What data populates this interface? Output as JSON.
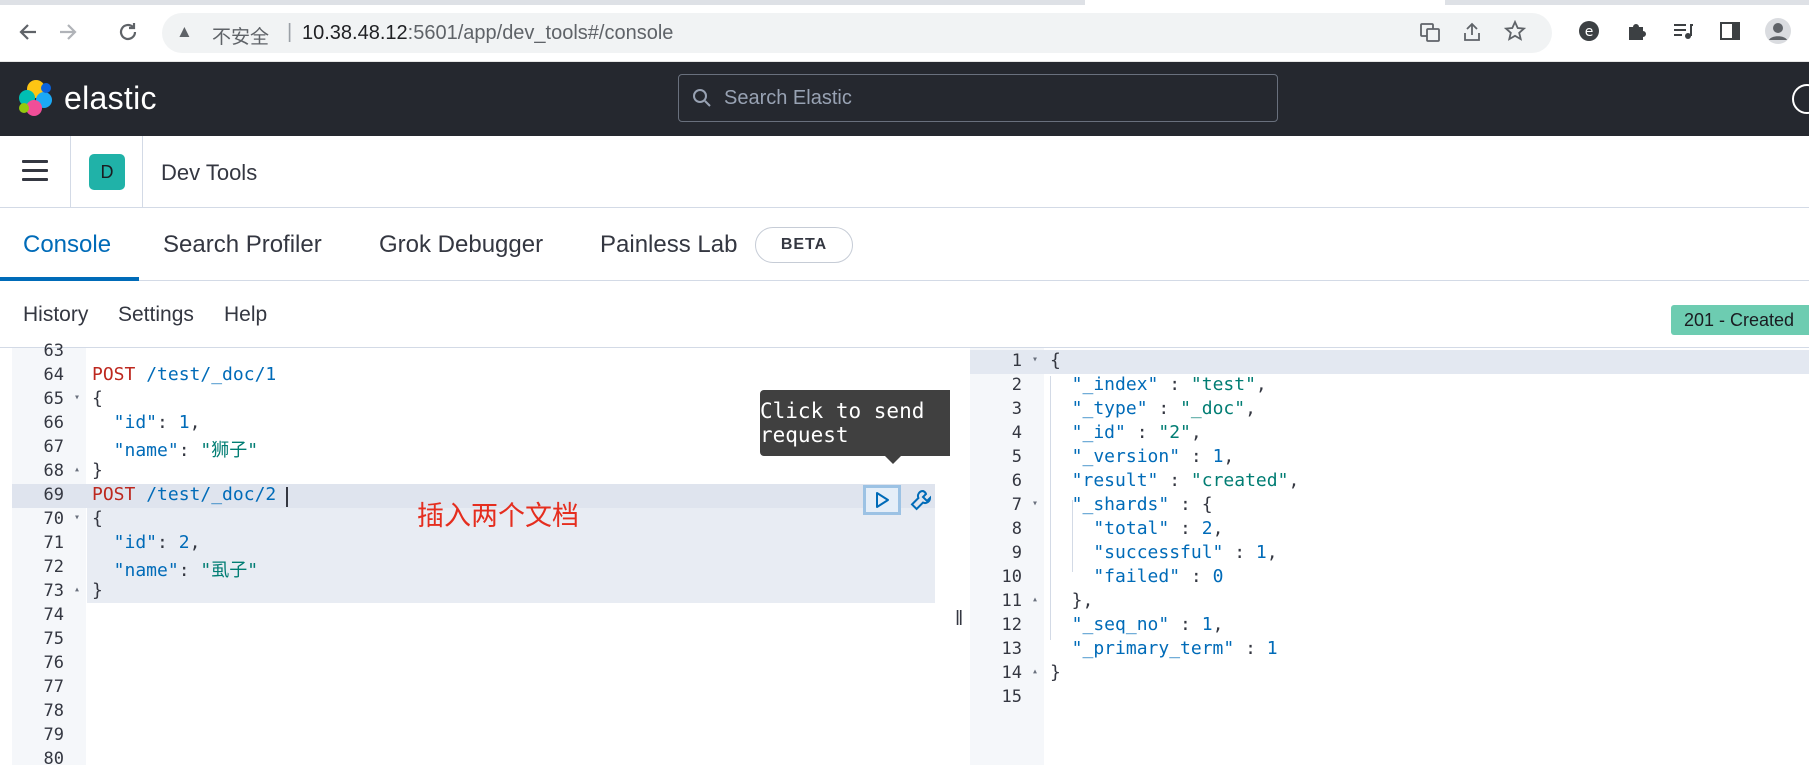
{
  "browser": {
    "insecure_label": "不安全",
    "separator": "|",
    "url_host": "10.38.48.12",
    "url_path": ":5601/app/dev_tools#/console"
  },
  "header": {
    "brand": "elastic",
    "search_placeholder": "Search Elastic"
  },
  "app_bar": {
    "space_initial": "D",
    "title": "Dev Tools"
  },
  "tabs": [
    {
      "label": "Console",
      "active": true
    },
    {
      "label": "Search Profiler",
      "active": false
    },
    {
      "label": "Grok Debugger",
      "active": false
    },
    {
      "label": "Painless Lab",
      "active": false
    }
  ],
  "beta_label": "BETA",
  "console_menu": {
    "history": "History",
    "settings": "Settings",
    "help": "Help"
  },
  "status": "201 - Created",
  "tooltip": "Click to send request",
  "annotation": "插入两个文档",
  "request_editor": {
    "lines": [
      {
        "n": "63",
        "fold": ""
      },
      {
        "n": "64",
        "fold": ""
      },
      {
        "n": "65",
        "fold": "▾"
      },
      {
        "n": "66",
        "fold": ""
      },
      {
        "n": "67",
        "fold": ""
      },
      {
        "n": "68",
        "fold": "▴"
      },
      {
        "n": "69",
        "fold": ""
      },
      {
        "n": "70",
        "fold": "▾"
      },
      {
        "n": "71",
        "fold": ""
      },
      {
        "n": "72",
        "fold": ""
      },
      {
        "n": "73",
        "fold": "▴"
      },
      {
        "n": "74",
        "fold": ""
      },
      {
        "n": "75",
        "fold": ""
      },
      {
        "n": "76",
        "fold": ""
      },
      {
        "n": "77",
        "fold": ""
      },
      {
        "n": "78",
        "fold": ""
      },
      {
        "n": "79",
        "fold": ""
      },
      {
        "n": "80",
        "fold": ""
      }
    ],
    "code": {
      "l64_method": "POST",
      "l64_path": " /test/_doc/1",
      "l65": "{",
      "l66_key": "  \"id\"",
      "l66_rest": ": ",
      "l66_val": "1",
      "l66_end": ",",
      "l67_key": "  \"name\"",
      "l67_rest": ": ",
      "l67_val": "\"狮子\"",
      "l68": "}",
      "l69_method": "POST",
      "l69_path": " /test/_doc/2",
      "l70": "{",
      "l71_key": "  \"id\"",
      "l71_rest": ": ",
      "l71_val": "2",
      "l71_end": ",",
      "l72_key": "  \"name\"",
      "l72_rest": ": ",
      "l72_val": "\"虱子\"",
      "l73": "}"
    }
  },
  "response_editor": {
    "lines": [
      {
        "n": "1",
        "fold": "▾"
      },
      {
        "n": "2",
        "fold": ""
      },
      {
        "n": "3",
        "fold": ""
      },
      {
        "n": "4",
        "fold": ""
      },
      {
        "n": "5",
        "fold": ""
      },
      {
        "n": "6",
        "fold": ""
      },
      {
        "n": "7",
        "fold": "▾"
      },
      {
        "n": "8",
        "fold": ""
      },
      {
        "n": "9",
        "fold": ""
      },
      {
        "n": "10",
        "fold": ""
      },
      {
        "n": "11",
        "fold": "▴"
      },
      {
        "n": "12",
        "fold": ""
      },
      {
        "n": "13",
        "fold": ""
      },
      {
        "n": "14",
        "fold": "▴"
      },
      {
        "n": "15",
        "fold": ""
      }
    ],
    "code": [
      [
        {
          "t": "{",
          "c": "p"
        }
      ],
      [
        {
          "t": "  \"_index\"",
          "c": "k"
        },
        {
          "t": " : ",
          "c": "p"
        },
        {
          "t": "\"test\"",
          "c": "s"
        },
        {
          "t": ",",
          "c": "p"
        }
      ],
      [
        {
          "t": "  \"_type\"",
          "c": "k"
        },
        {
          "t": " : ",
          "c": "p"
        },
        {
          "t": "\"_doc\"",
          "c": "s"
        },
        {
          "t": ",",
          "c": "p"
        }
      ],
      [
        {
          "t": "  \"_id\"",
          "c": "k"
        },
        {
          "t": " : ",
          "c": "p"
        },
        {
          "t": "\"2\"",
          "c": "s"
        },
        {
          "t": ",",
          "c": "p"
        }
      ],
      [
        {
          "t": "  \"_version\"",
          "c": "k"
        },
        {
          "t": " : ",
          "c": "p"
        },
        {
          "t": "1",
          "c": "n"
        },
        {
          "t": ",",
          "c": "p"
        }
      ],
      [
        {
          "t": "  \"result\"",
          "c": "k"
        },
        {
          "t": " : ",
          "c": "p"
        },
        {
          "t": "\"created\"",
          "c": "s"
        },
        {
          "t": ",",
          "c": "p"
        }
      ],
      [
        {
          "t": "  \"_shards\"",
          "c": "k"
        },
        {
          "t": " : {",
          "c": "p"
        }
      ],
      [
        {
          "t": "    \"total\"",
          "c": "k"
        },
        {
          "t": " : ",
          "c": "p"
        },
        {
          "t": "2",
          "c": "n"
        },
        {
          "t": ",",
          "c": "p"
        }
      ],
      [
        {
          "t": "    \"successful\"",
          "c": "k"
        },
        {
          "t": " : ",
          "c": "p"
        },
        {
          "t": "1",
          "c": "n"
        },
        {
          "t": ",",
          "c": "p"
        }
      ],
      [
        {
          "t": "    \"failed\"",
          "c": "k"
        },
        {
          "t": " : ",
          "c": "p"
        },
        {
          "t": "0",
          "c": "n"
        }
      ],
      [
        {
          "t": "  },",
          "c": "p"
        }
      ],
      [
        {
          "t": "  \"_seq_no\"",
          "c": "k"
        },
        {
          "t": " : ",
          "c": "p"
        },
        {
          "t": "1",
          "c": "n"
        },
        {
          "t": ",",
          "c": "p"
        }
      ],
      [
        {
          "t": "  \"_primary_term\"",
          "c": "k"
        },
        {
          "t": " : ",
          "c": "p"
        },
        {
          "t": "1",
          "c": "n"
        }
      ],
      [
        {
          "t": "}",
          "c": "p"
        }
      ],
      []
    ]
  }
}
